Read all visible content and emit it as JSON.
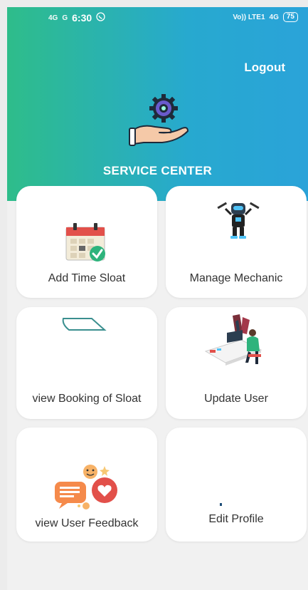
{
  "status_bar": {
    "net1": "4G",
    "net2": "G",
    "time": "6:30",
    "right_label": "Vo)) LTE1",
    "right_net": "4G",
    "battery": "75"
  },
  "header": {
    "logout_label": "Logout",
    "title": "SERVICE CENTER"
  },
  "cards": [
    {
      "label": "Add Time Sloat"
    },
    {
      "label": "Manage Mechanic"
    },
    {
      "label": "view Booking of Sloat"
    },
    {
      "label": "Update User"
    },
    {
      "label": "view User Feedback"
    },
    {
      "label": "Edit Profile"
    }
  ],
  "colors": {
    "header_start": "#2ebd8a",
    "header_end": "#2aa3d9",
    "card_bg": "#ffffff",
    "page_bg": "#f1f1f1"
  },
  "icons": {
    "logo": "gear-in-hand-icon",
    "card1": "calendar-check-icon",
    "card2": "mechanic-robot-icon",
    "card3": "broken-image-icon",
    "card4": "user-at-desk-icon",
    "card5": "chat-bubbles-icon",
    "card6": "loading-dot-icon"
  }
}
